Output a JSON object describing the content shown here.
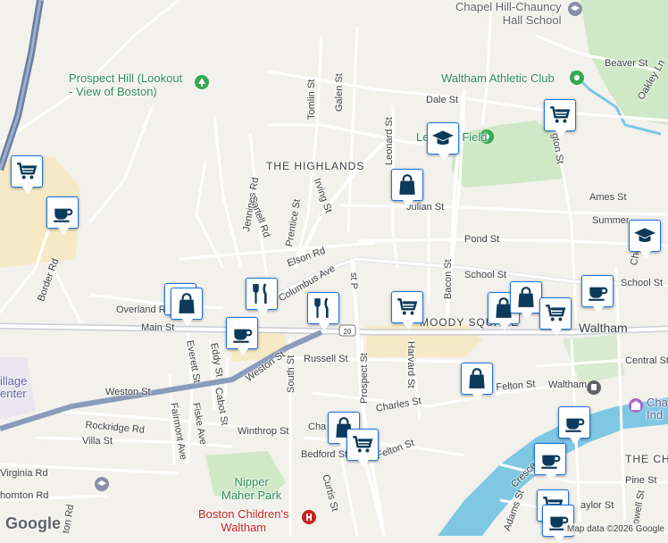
{
  "map": {
    "places": {
      "chapel_hill": "Chapel Hill-Chauncy\nHall School",
      "prospect_hill": "Prospect Hill (Lookout\n- View of Boston)",
      "waltham_athletic": "Waltham Athletic Club",
      "leonard_field": "Leonard Field",
      "nipper_maher": "Nipper\nMaher Park",
      "boston_childrens": "Boston Children's\nWaltham",
      "charles_river_museum": "Cha\nInd",
      "village_center": "illage\nenter"
    },
    "areas": {
      "highlands": "THE HIGHLANDS",
      "moody_square": "MOODY SQUARE",
      "the_chase": "THE CH"
    },
    "towns": {
      "waltham": "Waltham"
    },
    "streets": {
      "beaver": "Beaver St",
      "dale": "Dale St",
      "oakley": "Oakley Ln",
      "tomlin": "Tomlin St",
      "galen": "Galen St",
      "leonard": "Leonard St",
      "irving": "Irving St",
      "prentice": "Prentice St",
      "jennings": "Jennings Rd",
      "sartell": "Sartell Rd",
      "elson": "Elson Rd",
      "columbus": "Columbus Ave",
      "julian": "Julian St",
      "pond": "Pond St",
      "ames": "Ames St",
      "summer": "Summer",
      "school": "School St",
      "school2": "School St",
      "bacon": "Bacon St",
      "overland": "Overland Rd",
      "main": "Main St",
      "weston": "Weston St",
      "weston2": "Weston St",
      "border": "Border Rd",
      "everett": "Everett St",
      "eddy": "Eddy St",
      "south": "South St",
      "russell": "Russell St",
      "prospect": "Prospect St",
      "harvard": "Harvard St",
      "central": "Central St",
      "felton": "Felton St",
      "charles": "Charles St",
      "fairmont": "Fairmont Ave",
      "fiske": "Fiske Ave",
      "cabot": "Cabot St",
      "rockridge": "Rockridge Rd",
      "villa": "Villa St",
      "winthrop": "Winthrop St",
      "bedford": "Bedford St",
      "felton2": "Felton St",
      "curtis": "Curtis St",
      "virginia": "Virginia Rd",
      "thornton": "hornton Rd",
      "crescent": "Crescen",
      "pine": "Pine St",
      "adams": "Adams St",
      "taylor": "aylor St",
      "church": "Chu",
      "lex": "gton St",
      "well": "owell St",
      "tonrd": "ton Rd",
      "charles_short": "Cha",
      "waltham_station": "Waltham",
      "pst": "st P",
      "route": "20"
    },
    "attribution": "Map data ©2026 Google",
    "logo": "Google"
  },
  "markers": [
    {
      "type": "grocery",
      "icon": "shopping-cart-icon"
    },
    {
      "type": "cafe",
      "icon": "coffee-cup-icon"
    },
    {
      "type": "school",
      "icon": "graduation-cap-icon"
    },
    {
      "type": "grocery",
      "icon": "shopping-cart-icon"
    },
    {
      "type": "shop",
      "icon": "shopping-bag-icon"
    },
    {
      "type": "school",
      "icon": "graduation-cap-icon"
    },
    {
      "type": "cafe",
      "icon": "coffee-cup-icon"
    },
    {
      "type": "shop",
      "icon": "shopping-bag-icon"
    },
    {
      "type": "shop",
      "icon": "shopping-bag-icon"
    },
    {
      "type": "restaurant",
      "icon": "fork-knife-icon"
    },
    {
      "type": "cafe",
      "icon": "coffee-cup-icon"
    },
    {
      "type": "restaurant",
      "icon": "fork-knife-icon"
    },
    {
      "type": "grocery",
      "icon": "shopping-cart-icon"
    },
    {
      "type": "shop",
      "icon": "shopping-bag-icon"
    },
    {
      "type": "shop",
      "icon": "shopping-bag-icon"
    },
    {
      "type": "grocery",
      "icon": "shopping-cart-icon"
    },
    {
      "type": "shop",
      "icon": "shopping-bag-icon"
    },
    {
      "type": "cafe",
      "icon": "coffee-cup-icon"
    },
    {
      "type": "shop",
      "icon": "shopping-bag-icon"
    },
    {
      "type": "grocery",
      "icon": "shopping-cart-icon"
    },
    {
      "type": "cafe",
      "icon": "coffee-cup-icon"
    },
    {
      "type": "grocery",
      "icon": "shopping-cart-icon"
    },
    {
      "type": "cafe",
      "icon": "coffee-cup-icon"
    }
  ],
  "colors": {
    "pin_icon": "#0b3a5b",
    "pin_border": "#1a73e8",
    "park": "#cfe8c6",
    "water": "#7ec8e3",
    "highway": "#6b7fa3",
    "commercial": "#f6eac6"
  }
}
